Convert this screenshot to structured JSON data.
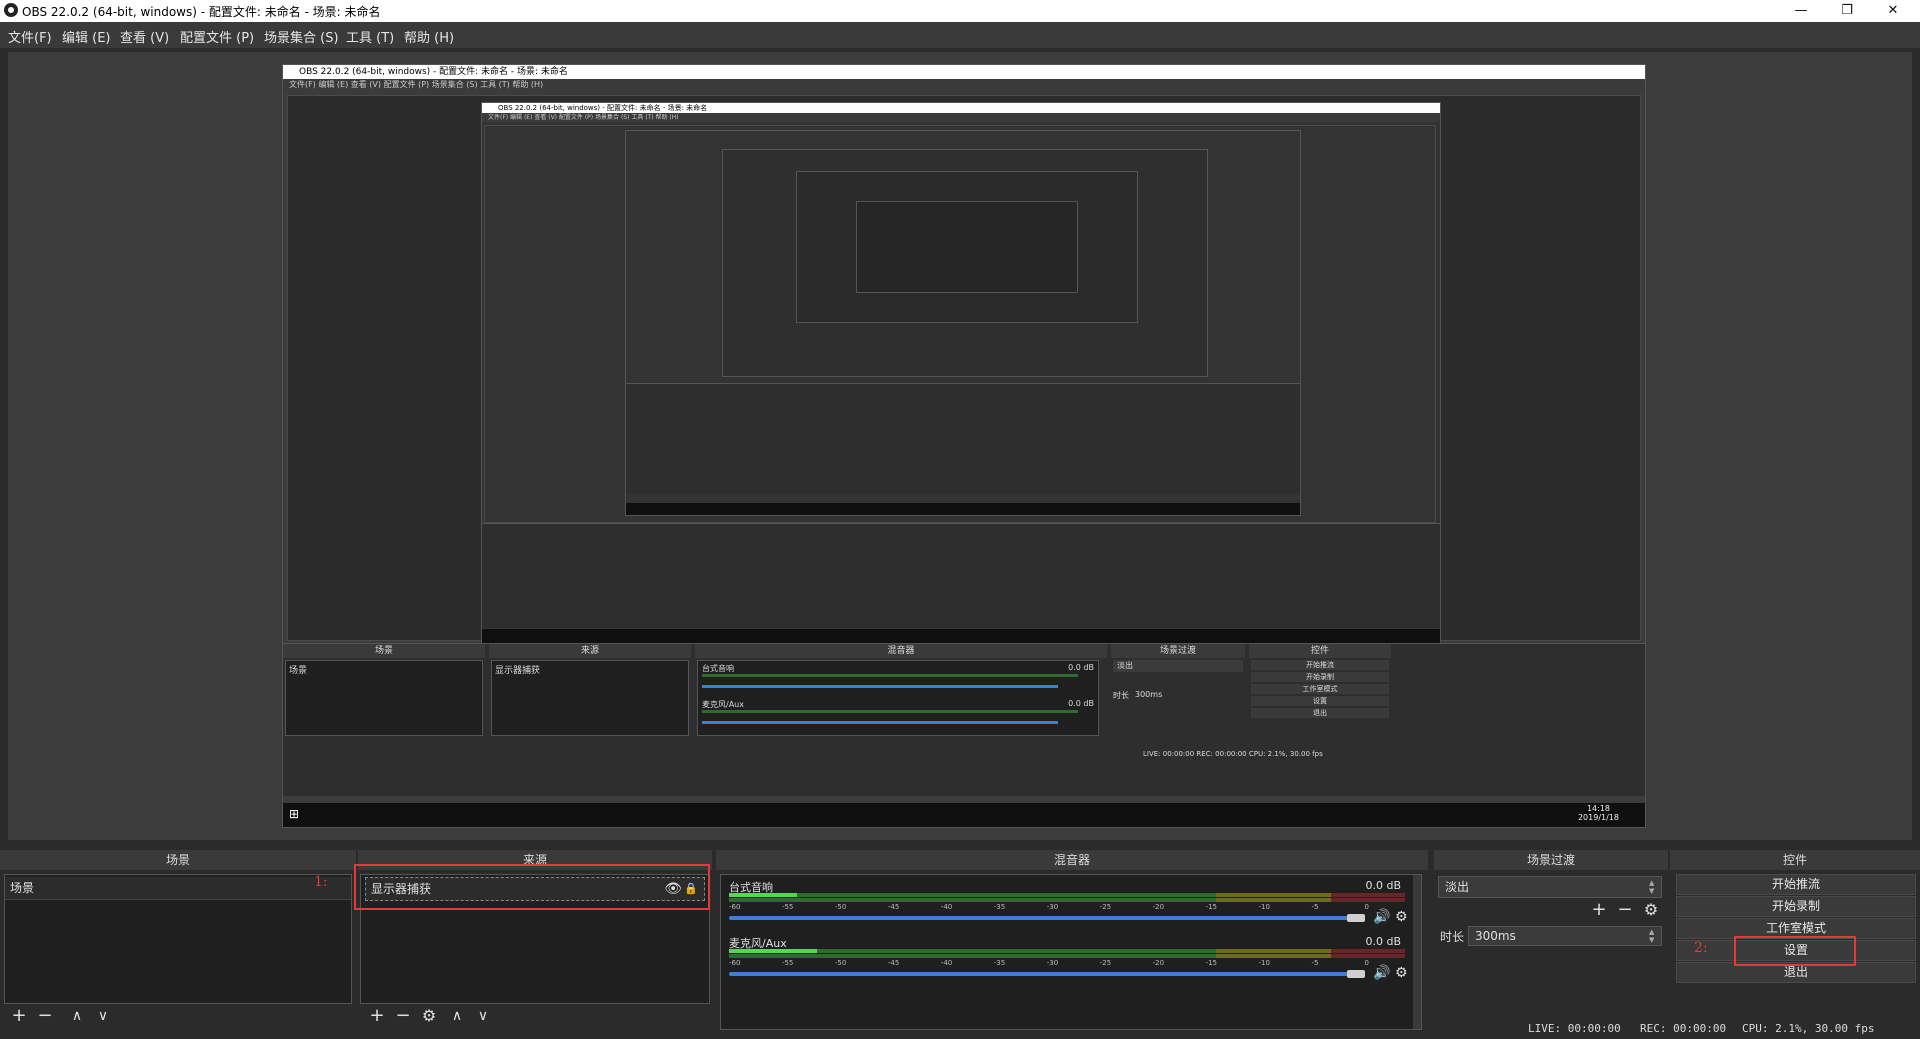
{
  "window": {
    "title": "OBS 22.0.2 (64-bit, windows) - 配置文件: 未命名 - 场景: 未命名",
    "minimize": "—",
    "maximize": "❐",
    "close": "✕"
  },
  "menu": [
    "文件(F)",
    "编辑 (E)",
    "查看 (V)",
    "配置文件 (P)",
    "场景集合 (S)",
    "工具 (T)",
    "帮助 (H)"
  ],
  "preview": {
    "nested_title": "OBS 22.0.2 (64-bit, windows) - 配置文件: 未命名 - 场景: 未命名",
    "nested_menu": "文件(F)  编辑 (E)  查看 (V)  配置文件 (P)  场景集合 (S)  工具 (T)  帮助 (H)",
    "nested_scene_header": "场景",
    "nested_source_header": "来源",
    "nested_mixer_header": "混音器",
    "nested_transition_header": "场景过渡",
    "nested_controls_header": "控件",
    "nested_scene_item": "场景",
    "nested_source_item": "显示器捕获",
    "nested_track1": "台式音响",
    "nested_track2": "麦克风/Aux",
    "nested_db": "0.0 dB",
    "nested_fade": "淡出",
    "nested_duration": "时长",
    "nested_duration_val": "300ms",
    "nested_controls": [
      "开始推流",
      "开始录制",
      "工作室模式",
      "设置",
      "退出"
    ],
    "nested_status": "LIVE: 00:00:00    REC: 00:00:00    CPU: 2.1%, 30.00 fps",
    "nested_time": "14:18",
    "nested_date": "2019/1/18"
  },
  "scenes": {
    "header": "场景",
    "items": [
      "场景"
    ],
    "annotation": "1:"
  },
  "sources": {
    "header": "来源",
    "items": [
      "显示器捕获"
    ]
  },
  "mixer": {
    "header": "混音器",
    "tracks": [
      {
        "name": "台式音响",
        "db": "0.0 dB",
        "level": 0.1
      },
      {
        "name": "麦克风/Aux",
        "db": "0.0 dB",
        "level": 0.13
      }
    ],
    "ticks": [
      "-60",
      "-55",
      "-50",
      "-45",
      "-40",
      "-35",
      "-30",
      "-25",
      "-20",
      "-15",
      "-10",
      "-5",
      "0"
    ]
  },
  "transitions": {
    "header": "场景过渡",
    "selected": "淡出",
    "duration_label": "时长",
    "duration_value": "300ms"
  },
  "controls": {
    "header": "控件",
    "buttons": [
      "开始推流",
      "开始录制",
      "工作室模式",
      "设置",
      "退出"
    ],
    "annotation": "2:"
  },
  "status": {
    "live": "LIVE: 00:00:00",
    "rec": "REC: 00:00:00",
    "cpu": "CPU: 2.1%, 30.00 fps"
  },
  "colors": {
    "highlight": "#e03a3a",
    "fader": "#3d7fd6",
    "meter_green": "#59d459"
  }
}
